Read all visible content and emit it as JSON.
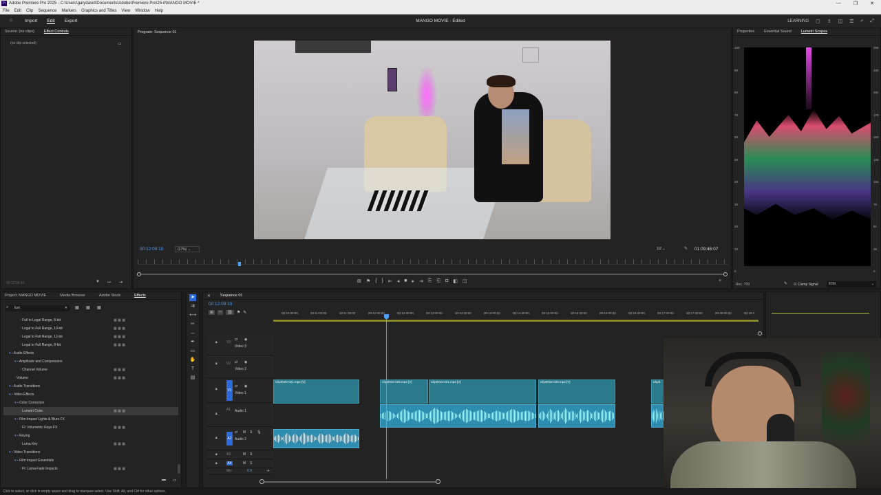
{
  "window": {
    "title": "Adobe Premiere Pro 2025 - C:\\Users\\garydavid\\Documents\\Adobe\\Premiere Pro\\25.0\\MANGO MOVIE *",
    "controls": [
      "—",
      "❐",
      "✕"
    ]
  },
  "menu": [
    "File",
    "Edit",
    "Clip",
    "Sequence",
    "Markers",
    "Graphics and Titles",
    "View",
    "Window",
    "Help"
  ],
  "appbar": {
    "nav": [
      "Import",
      "Edit",
      "Export"
    ],
    "active": "Edit",
    "project_title": "MANGO MOVIE - Edited",
    "learning": "LEARNING"
  },
  "source_panel": {
    "tabs": [
      "Source: (no clips)",
      "Effect Controls"
    ],
    "active_tab": "Effect Controls",
    "empty_text": "(no clip selected)",
    "timecode": "00:12:09:10"
  },
  "program": {
    "tab": "Program: Sequence 01",
    "timecode": "00:12:09:10",
    "zoom": "(27%)",
    "resolution": "1/2",
    "duration": "01:09:46:07"
  },
  "scopes": {
    "tabs": [
      "Properties",
      "Essential Sound",
      "Lumetri Scopes"
    ],
    "active_tab": "Lumetri Scopes",
    "left_scale": [
      "100",
      "90",
      "80",
      "70",
      "60",
      "50",
      "40",
      "30",
      "20",
      "10",
      "0"
    ],
    "right_scale": [
      "255",
      "230",
      "204",
      "178",
      "153",
      "128",
      "102",
      "76",
      "51",
      "25",
      "0"
    ],
    "footer_left": "Rec. 709",
    "clamp_label": "Clamp Signal",
    "bit_depth": "8 Bit"
  },
  "project_panel": {
    "tabs": [
      "Project: MANGO MOVIE",
      "Media Browser",
      "Adobe Stock",
      "Effects"
    ],
    "active_tab": "Effects",
    "search_value": "lum",
    "tree": [
      {
        "label": "Full to Legal Range, 8-bit",
        "indent": 3
      },
      {
        "label": "Legal to Full Range, 10-bit",
        "indent": 3
      },
      {
        "label": "Legal to Full Range, 12-bit",
        "indent": 3
      },
      {
        "label": "Legal to Full Range, 8-bit",
        "indent": 3
      },
      {
        "label": "Audio Effects",
        "indent": 1,
        "folder": true
      },
      {
        "label": "Amplitude and Compression",
        "indent": 2,
        "folder": true
      },
      {
        "label": "Channel Volume",
        "indent": 3
      },
      {
        "label": "Volume",
        "indent": 2
      },
      {
        "label": "Audio Transitions",
        "indent": 1,
        "folder": true
      },
      {
        "label": "Video Effects",
        "indent": 1,
        "folder": true
      },
      {
        "label": "Color Correction",
        "indent": 2,
        "folder": true
      },
      {
        "label": "Lumetri Color",
        "indent": 3,
        "selected": true
      },
      {
        "label": "Film Impact Lights & Blurs FX",
        "indent": 2,
        "folder": true
      },
      {
        "label": "FI: Volumetric Rays FX",
        "indent": 3
      },
      {
        "label": "Keying",
        "indent": 2,
        "folder": true
      },
      {
        "label": "Luma Key",
        "indent": 3
      },
      {
        "label": "Video Transitions",
        "indent": 1,
        "folder": true
      },
      {
        "label": "Film Impact Essentials",
        "indent": 2,
        "folder": true
      },
      {
        "label": "FI: Luma Fade Impacts",
        "indent": 3
      }
    ]
  },
  "timeline": {
    "tab": "Sequence 01",
    "timecode": "00:12:09:10",
    "ruler": [
      "00:10:30:00",
      "00:11:00:00",
      "00:11:30:00",
      "00:12:00:00",
      "00:12:30:00",
      "00:13:00:00",
      "00:13:30:00",
      "00:14:00:00",
      "00:14:30:00",
      "00:15:00:00",
      "00:15:30:00",
      "00:16:00:00",
      "00:16:30:00",
      "00:17:00:00",
      "00:17:30:00",
      "00:18:00:00",
      "00:18:3"
    ],
    "tracks": [
      {
        "id": "V3",
        "name": "Video 3"
      },
      {
        "id": "V2",
        "name": "Video 2"
      },
      {
        "id": "V1",
        "name": "Video 1"
      },
      {
        "id": "A1",
        "name": "Audio 1"
      },
      {
        "id": "A2",
        "name": "Audio 2"
      },
      {
        "id": "A3",
        "name": ""
      },
      {
        "id": "A4",
        "name": ""
      },
      {
        "id": "Mix",
        "name": "0.0"
      }
    ],
    "video_clips": [
      "Clip0020-021.mp4 [V]",
      "Clip0016-025.mp4 [V]",
      "Clip0016-021.mp4 [V]",
      "Clip0016-025.mp4 [V]",
      "Clip0"
    ]
  },
  "status": "Click to select, or click in empty space and drag to marquee select. Use Shift, Alt, and Ctrl for other options."
}
